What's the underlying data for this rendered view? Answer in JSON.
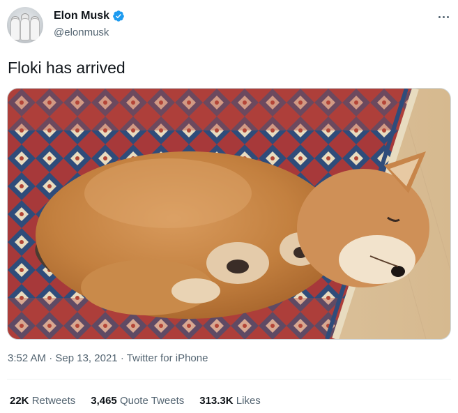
{
  "author": {
    "name": "Elon Musk",
    "handle": "@elonmusk",
    "verified": true,
    "verified_color": "#1d9bf0"
  },
  "tweet": {
    "text": "Floki has arrived",
    "media_description_icon": "photo-of-sleeping-shiba-puppy"
  },
  "meta": {
    "time": "3:52 AM",
    "sep1": "·",
    "date": "Sep 13, 2021",
    "sep2": "·",
    "source": "Twitter for iPhone"
  },
  "stats": [
    {
      "count": "22K",
      "label": "Retweets"
    },
    {
      "count": "3,465",
      "label": "Quote Tweets"
    },
    {
      "count": "313.3K",
      "label": "Likes"
    }
  ],
  "colors": {
    "text": "#0f1419",
    "secondary": "#536471",
    "accent": "#1d9bf0"
  }
}
